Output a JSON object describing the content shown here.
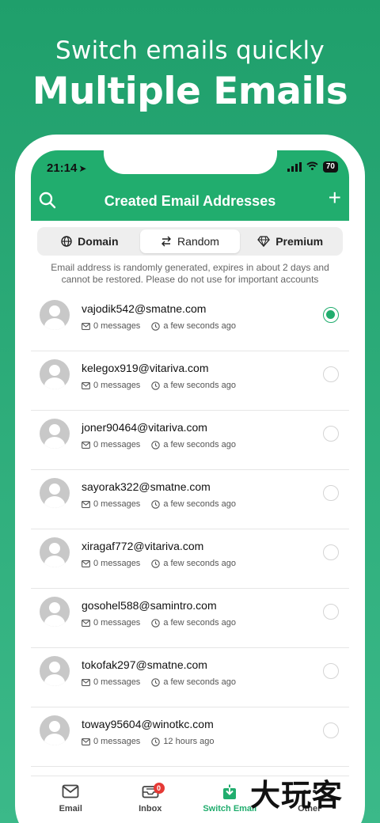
{
  "promo": {
    "subtitle": "Switch emails quickly",
    "title": "Multiple Emails"
  },
  "status_bar": {
    "time": "21:14",
    "battery": "70"
  },
  "header": {
    "title": "Created Email Addresses"
  },
  "segments": [
    {
      "label": "Domain",
      "icon": "globe-icon",
      "active": false
    },
    {
      "label": "Random",
      "icon": "swap-icon",
      "active": true
    },
    {
      "label": "Premium",
      "icon": "diamond-icon",
      "active": false
    }
  ],
  "notice": "Email address is randomly generated, expires in about 2 days and cannot be restored. Please do not use for important accounts",
  "emails": [
    {
      "address": "vajodik542@smatne.com",
      "messages": "0 messages",
      "time": "a few seconds ago",
      "selected": true
    },
    {
      "address": "kelegox919@vitariva.com",
      "messages": "0 messages",
      "time": "a few seconds ago",
      "selected": false
    },
    {
      "address": "joner90464@vitariva.com",
      "messages": "0 messages",
      "time": "a few seconds ago",
      "selected": false
    },
    {
      "address": "sayorak322@smatne.com",
      "messages": "0 messages",
      "time": "a few seconds ago",
      "selected": false
    },
    {
      "address": "xiragaf772@vitariva.com",
      "messages": "0 messages",
      "time": "a few seconds ago",
      "selected": false
    },
    {
      "address": "gosohel588@samintro.com",
      "messages": "0 messages",
      "time": "a few seconds ago",
      "selected": false
    },
    {
      "address": "tokofak297@smatne.com",
      "messages": "0 messages",
      "time": "a few seconds ago",
      "selected": false
    },
    {
      "address": "toway95604@winotkc.com",
      "messages": "0 messages",
      "time": "12 hours ago",
      "selected": false
    }
  ],
  "tabs": [
    {
      "label": "Email",
      "icon": "envelope-icon",
      "active": false
    },
    {
      "label": "Inbox",
      "icon": "inbox-icon",
      "active": false,
      "badge": "0"
    },
    {
      "label": "Switch Email",
      "icon": "switch-email-icon",
      "active": true
    },
    {
      "label": "Other",
      "icon": "other-icon",
      "active": false
    }
  ],
  "watermark": "大玩客",
  "colors": {
    "accent": "#21ad6e",
    "background_top": "#1f9f6b",
    "badge": "#e53935"
  }
}
